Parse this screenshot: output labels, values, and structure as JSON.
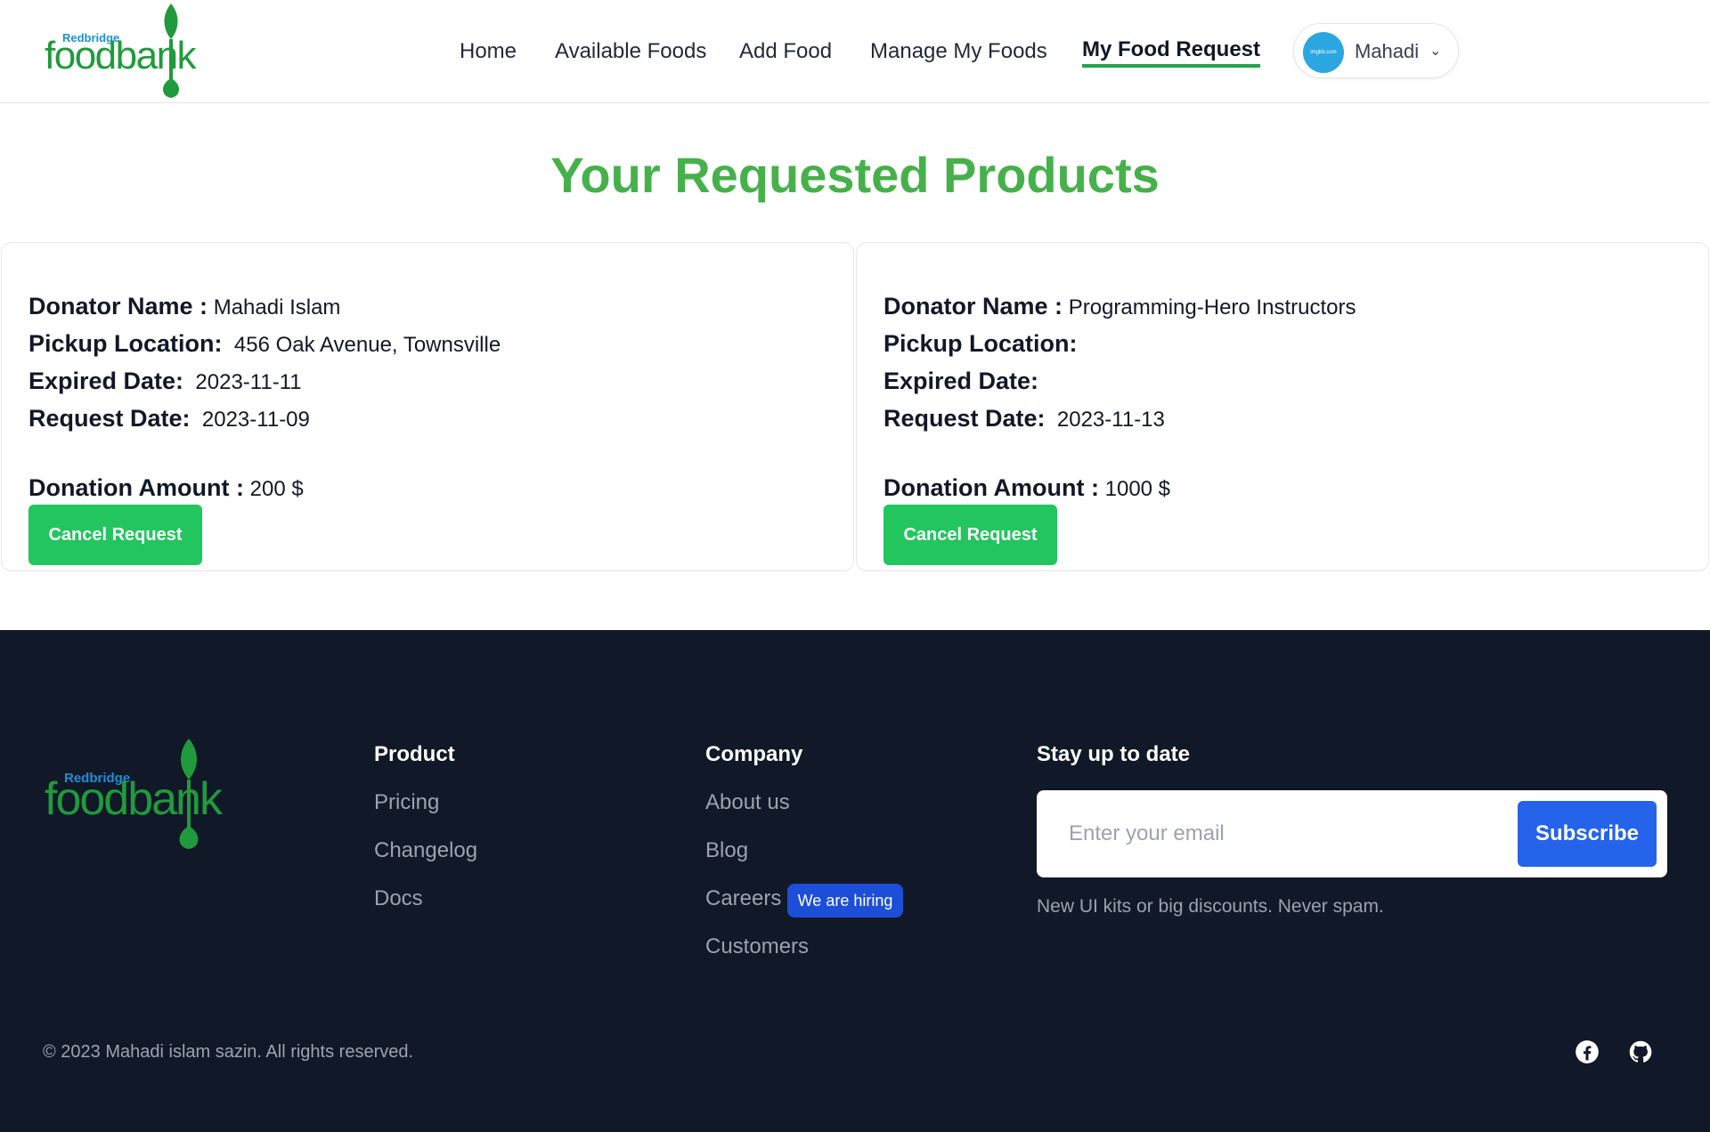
{
  "brand": {
    "small": "Redbridge",
    "big": "foodbank"
  },
  "nav": {
    "items": [
      "Home",
      "Available Foods",
      "Add Food",
      "Manage My Foods",
      "My Food Request"
    ],
    "active": "My Food Request"
  },
  "user": {
    "name": "Mahadi",
    "avatar_text": "imgbb.com"
  },
  "page": {
    "title": "Your Requested Products"
  },
  "labels": {
    "donator": "Donator Name :",
    "pickup": "Pickup Location:",
    "expired": "Expired Date:",
    "request": "Request Date:",
    "amount": "Donation Amount :",
    "cancel": "Cancel Request"
  },
  "requests": [
    {
      "donator": "Mahadi Islam",
      "pickup": "456 Oak Avenue, Townsville",
      "expired": "2023-11-11",
      "request_date": "2023-11-09",
      "amount": "200 $"
    },
    {
      "donator": "Programming-Hero Instructors",
      "pickup": "",
      "expired": "",
      "request_date": "2023-11-13",
      "amount": "1000 $"
    }
  ],
  "footer": {
    "product": {
      "heading": "Product",
      "links": [
        "Pricing",
        "Changelog",
        "Docs"
      ]
    },
    "company": {
      "heading": "Company",
      "links": [
        "About us",
        "Blog",
        "Careers",
        "Customers"
      ],
      "badge": "We are hiring"
    },
    "newsletter": {
      "heading": "Stay up to date",
      "placeholder": "Enter your email",
      "button": "Subscribe",
      "note": "New UI kits or big discounts. Never spam."
    },
    "copyright": "© 2023 Mahadi islam sazin. All rights reserved.",
    "social_icons": [
      "facebook-icon",
      "github-icon"
    ]
  },
  "colors": {
    "green": "#22c55e",
    "title_green": "#46b04b",
    "footer_bg": "#111827",
    "blue": "#2563eb"
  }
}
